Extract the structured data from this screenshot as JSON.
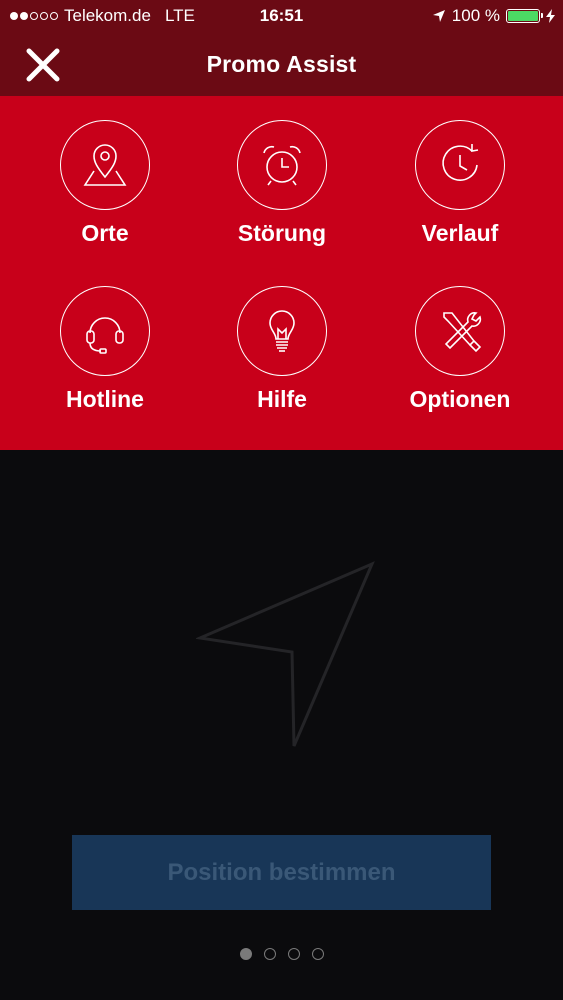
{
  "status_bar": {
    "carrier": "Telekom.de",
    "network": "LTE",
    "time": "16:51",
    "battery": "100 %",
    "signal_filled": 2,
    "signal_empty": 3
  },
  "nav": {
    "title": "Promo Assist",
    "close_icon": "close-icon"
  },
  "menu": {
    "items": [
      {
        "label": "Orte",
        "icon": "map-pin-icon"
      },
      {
        "label": "Störung",
        "icon": "alarm-clock-icon"
      },
      {
        "label": "Verlauf",
        "icon": "history-clock-icon"
      },
      {
        "label": "Hotline",
        "icon": "headset-icon"
      },
      {
        "label": "Hilfe",
        "icon": "lightbulb-icon"
      },
      {
        "label": "Optionen",
        "icon": "tools-icon"
      }
    ]
  },
  "map": {
    "icon": "location-arrow-icon",
    "button_label": "Position bestimmen",
    "pager": {
      "count": 4,
      "active": 1
    }
  },
  "colors": {
    "header": "#6b0a14",
    "menu_bg": "#c8001a",
    "map_bg": "#0b0b0d",
    "button_bg": "#183657",
    "button_text": "#3a5877",
    "battery_fill": "#4cd964"
  }
}
